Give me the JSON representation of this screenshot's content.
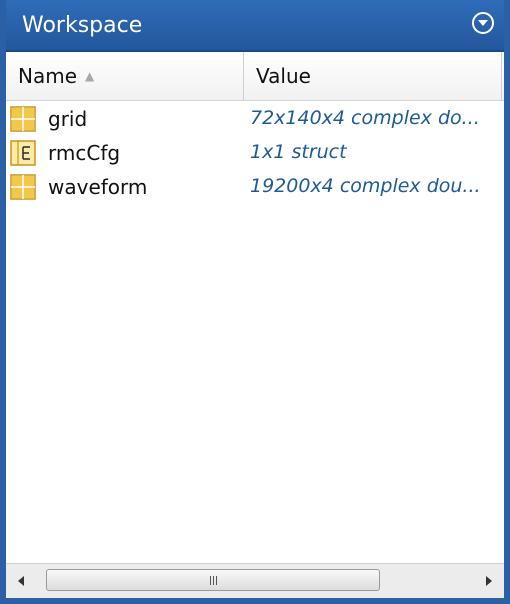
{
  "window": {
    "title": "Workspace",
    "titlebar_color": "#2b5fa6"
  },
  "columns": {
    "name": "Name",
    "value": "Value"
  },
  "variables": [
    {
      "name": "grid",
      "value": "72x140x4 complex do...",
      "icon": "matrix-icon"
    },
    {
      "name": "rmcCfg",
      "value": "1x1 struct",
      "icon": "struct-icon"
    },
    {
      "name": "waveform",
      "value": "19200x4 complex dou...",
      "icon": "matrix-icon"
    }
  ],
  "colors": {
    "value_text": "#1f5a96",
    "matrix_icon": "#e8b62c"
  }
}
